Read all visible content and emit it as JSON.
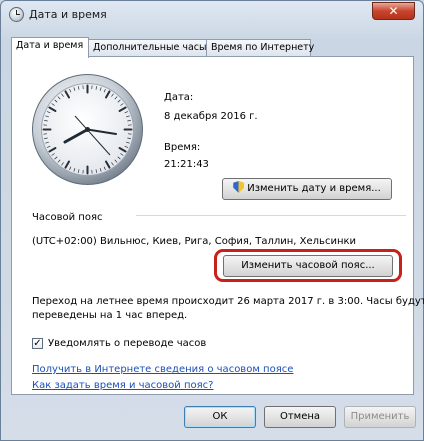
{
  "window": {
    "title": "Дата и время",
    "close_label": "✕"
  },
  "tabs": [
    {
      "label": "Дата и время",
      "active": true
    },
    {
      "label": "Дополнительные часы",
      "active": false
    },
    {
      "label": "Время по Интернету",
      "active": false
    }
  ],
  "datetime": {
    "date_label": "Дата:",
    "date_value": "8 декабря 2016 г.",
    "time_label": "Время:",
    "time_value": "21:21:43",
    "change_button": "Изменить дату и время..."
  },
  "timezone": {
    "section_label": "Часовой пояс",
    "value": "(UTC+02:00) Вильнюс, Киев, Рига, София, Таллин, Хельсинки",
    "change_button": "Изменить часовой пояс..."
  },
  "dst": {
    "line1": "Переход на летнее время происходит 26 марта 2017 г. в 3:00. Часы будут",
    "line2": "переведены на 1 час вперед.",
    "notify_label": "Уведомлять о переводе часов",
    "notify_checked": true
  },
  "links": {
    "online_info": "Получить в Интернете сведения о часовом поясе",
    "how_to": "Как задать время и часовой пояс?"
  },
  "footer": {
    "ok": "ОК",
    "cancel": "Отмена",
    "apply": "Применить"
  },
  "colors": {
    "highlight": "#c8201a",
    "link": "#1a4fb8"
  }
}
